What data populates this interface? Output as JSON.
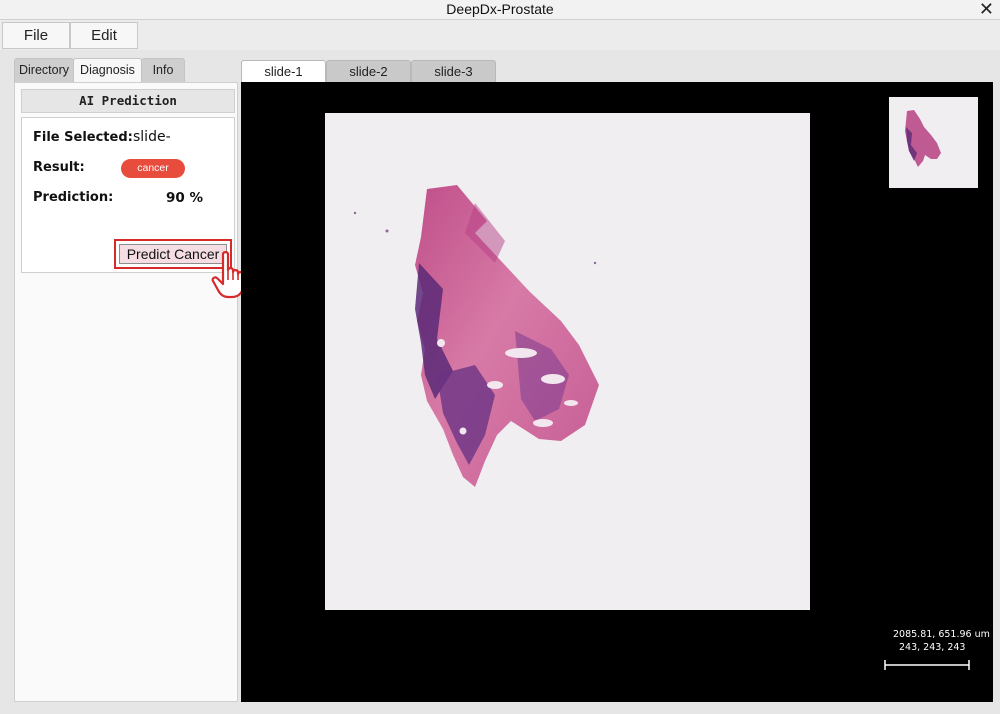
{
  "window": {
    "title": "DeepDx-Prostate",
    "close_glyph": "✕"
  },
  "menu": {
    "file": "File",
    "edit": "Edit"
  },
  "side_tabs": {
    "directory": "Directory",
    "diagnosis": "Diagnosis",
    "info": "Info"
  },
  "prediction": {
    "header": "AI Prediction",
    "file_selected_label": "File Selected:",
    "file_selected_value": "slide-",
    "result_label": "Result:",
    "result_value": "cancer",
    "prediction_label": "Prediction:",
    "prediction_value": "90 %",
    "predict_button": "Predict Cancer"
  },
  "slide_tabs": [
    "slide-1",
    "slide-2",
    "slide-3"
  ],
  "viewer": {
    "coordinates": "2085.81, 651.96 um",
    "pixel_rgb": "243, 243, 243"
  },
  "colors": {
    "badge": "#e84c3d",
    "highlight": "#d62b2b",
    "tissue_pink": "#d56a9c",
    "tissue_purple": "#5b2a77",
    "viewer_bg": "#000000"
  },
  "icons": {
    "close": "close-icon",
    "hand": "hand-pointer-icon"
  }
}
